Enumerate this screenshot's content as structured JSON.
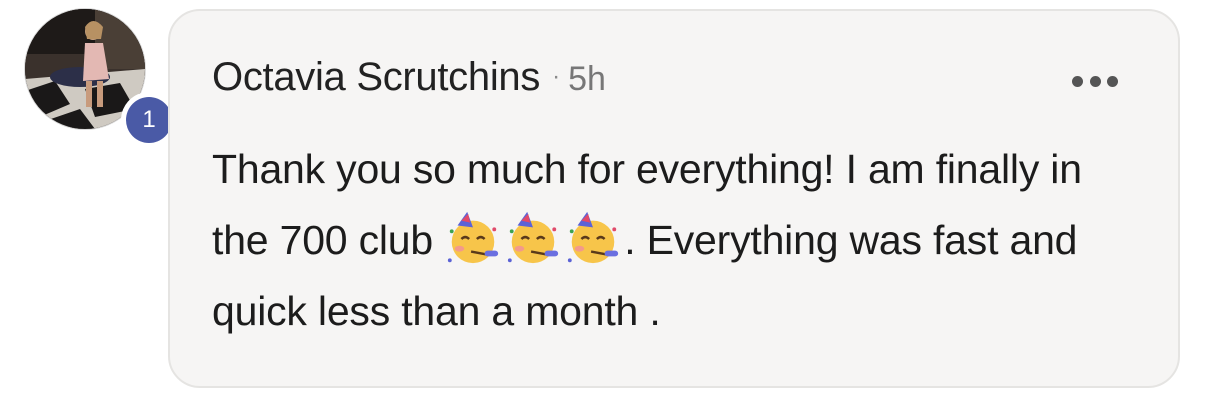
{
  "comment": {
    "author": "Octavia Scrutchins",
    "separator": "·",
    "timestamp": "5h",
    "badge_count": "1",
    "text_part1": "Thank you so much for everything! I am finally in the 700 club ",
    "text_part2": ". Everything was fast and quick less than a month .",
    "emoji_names": [
      "partying-face-emoji",
      "partying-face-emoji",
      "partying-face-emoji"
    ],
    "more_icon": "more-options-icon"
  },
  "colors": {
    "bubble_bg": "#f6f5f4",
    "bubble_border": "#e5e4e2",
    "badge_bg": "#4a5aa6",
    "text": "#1c1c1c",
    "meta": "#777777"
  }
}
